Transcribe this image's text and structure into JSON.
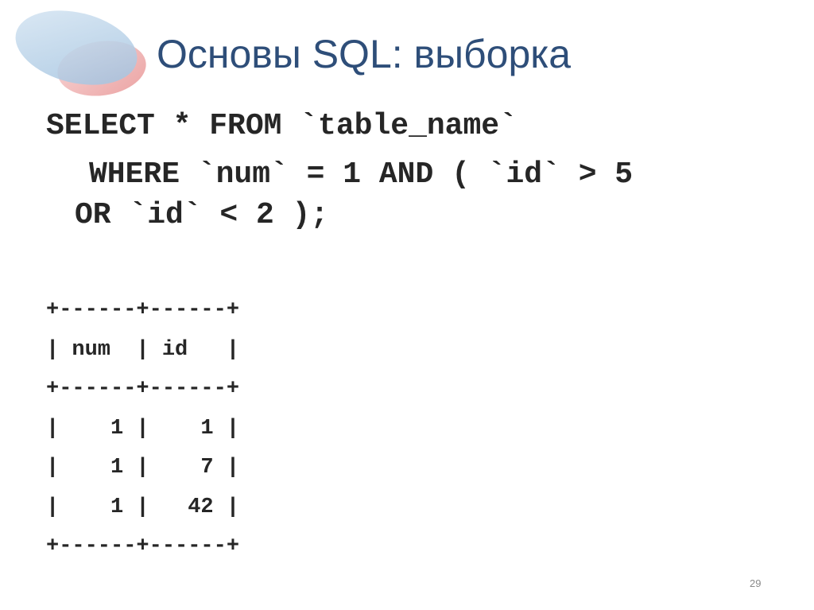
{
  "slide": {
    "title": "Основы SQL: выборка",
    "query_lines": [
      "SELECT * FROM `table_name`",
      "WHERE `num` = 1 AND ( `id` > 5",
      "OR `id` < 2 );"
    ],
    "result_table": {
      "lines": [
        "+------+------+",
        "| num  | id   |",
        "+------+------+",
        "|    1 |    1 |",
        "|    1 |    7 |",
        "|    1 |   42 |",
        "+------+------+"
      ],
      "columns": [
        "num",
        "id"
      ],
      "rows": [
        [
          1,
          1
        ],
        [
          1,
          7
        ],
        [
          1,
          42
        ]
      ]
    },
    "page_number": "29"
  },
  "colors": {
    "title": "#2e4e79",
    "text": "#262626",
    "logo_blue": "#b9d3e8",
    "logo_red": "#f0b6b6",
    "page_number": "#8a8a8a"
  },
  "icons": {
    "logo": "overlapping-ellipses-logo"
  }
}
